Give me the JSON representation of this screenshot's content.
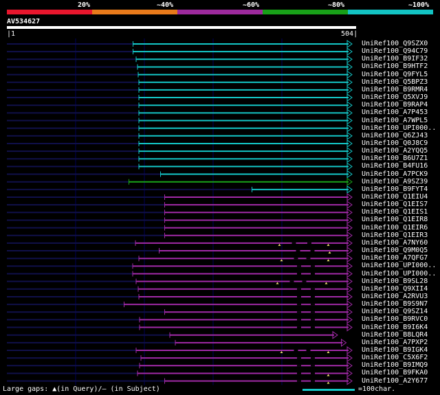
{
  "header": {
    "percent_labels": [
      "20%",
      "~40%",
      "~60%",
      "~80%",
      "~100%"
    ],
    "segment_colors": [
      "#e8162d",
      "#e87a1b",
      "#9d2a9d",
      "#18a018",
      "#13c4c4"
    ]
  },
  "query": {
    "name": "AV534627",
    "start_label": "1",
    "end_label": "504",
    "length": 504
  },
  "colors": {
    "cyan": "#14c8c8",
    "green": "#1aa51a",
    "purple": "#a22aa8",
    "navy": "#10104a",
    "grid": "#00005a",
    "marker": "#f0e070"
  },
  "hits": [
    {
      "id": "UniRef100_Q9SZX0",
      "color": "cyan",
      "start": 0.367
    },
    {
      "id": "UniRef100_Q94C79",
      "color": "cyan",
      "start": 0.367
    },
    {
      "id": "UniRef100_B9IF32",
      "color": "cyan",
      "start": 0.376
    },
    {
      "id": "UniRef100_B9HTF2",
      "color": "cyan",
      "start": 0.38
    },
    {
      "id": "UniRef100_Q9FYL5",
      "color": "cyan",
      "start": 0.382
    },
    {
      "id": "UniRef100_Q5BPZ3",
      "color": "cyan",
      "start": 0.384
    },
    {
      "id": "UniRef100_B9RMR4",
      "color": "cyan",
      "start": 0.384
    },
    {
      "id": "UniRef100_Q5XVJ9",
      "color": "cyan",
      "start": 0.384
    },
    {
      "id": "UniRef100_B9RAP4",
      "color": "cyan",
      "start": 0.384
    },
    {
      "id": "UniRef100_A7P453",
      "color": "cyan",
      "start": 0.384
    },
    {
      "id": "UniRef100_A7WPL5",
      "color": "cyan",
      "start": 0.384
    },
    {
      "id": "UniRef100_UPI000..",
      "color": "cyan",
      "start": 0.384
    },
    {
      "id": "UniRef100_Q6ZJ43",
      "color": "cyan",
      "start": 0.384
    },
    {
      "id": "UniRef100_Q0J8C9",
      "color": "cyan",
      "start": 0.384
    },
    {
      "id": "UniRef100_A2YQQ5",
      "color": "cyan",
      "start": 0.384
    },
    {
      "id": "UniRef100_B6U7Z1",
      "color": "cyan",
      "start": 0.384
    },
    {
      "id": "UniRef100_B4FU16",
      "color": "cyan",
      "start": 0.384
    },
    {
      "id": "UniRef100_A7PCK9",
      "color": "cyan",
      "start": 0.447
    },
    {
      "id": "UniRef100_A9SZ39",
      "color": "green",
      "start": 0.355
    },
    {
      "id": "UniRef100_B9FYT4",
      "color": "cyan",
      "start": 0.713
    },
    {
      "id": "UniRef100_Q1EIU4",
      "color": "purple",
      "start": 0.459
    },
    {
      "id": "UniRef100_Q1EIS7",
      "color": "purple",
      "start": 0.459
    },
    {
      "id": "UniRef100_Q1EIS1",
      "color": "purple",
      "start": 0.459
    },
    {
      "id": "UniRef100_Q1EIR8",
      "color": "purple",
      "start": 0.459
    },
    {
      "id": "UniRef100_Q1EIR6",
      "color": "purple",
      "start": 0.459
    },
    {
      "id": "UniRef100_Q1EIR3",
      "color": "purple",
      "start": 0.459
    },
    {
      "id": "UniRef100_A7NY60",
      "color": "purple",
      "start": 0.374,
      "markers": [
        0.793,
        0.935
      ],
      "gaps": [
        0.835,
        0.88
      ]
    },
    {
      "id": "UniRef100_Q9M0Q5",
      "color": "purple",
      "start": 0.443,
      "markers": [
        0.939
      ],
      "gaps": [
        0.847,
        0.889
      ]
    },
    {
      "id": "UniRef100_A7QFG7",
      "color": "purple",
      "start": 0.384,
      "markers": [
        0.799,
        0.935
      ],
      "gaps": [
        0.841,
        0.877
      ]
    },
    {
      "id": "UniRef100_UPI000..",
      "color": "purple",
      "start": 0.366,
      "gaps": [
        0.85,
        0.89
      ]
    },
    {
      "id": "UniRef100_UPI000..",
      "color": "purple",
      "start": 0.366,
      "gaps": [
        0.85,
        0.89
      ]
    },
    {
      "id": "UniRef100_B9SL28",
      "color": "purple",
      "start": 0.376,
      "markers": [
        0.787,
        0.929
      ],
      "gaps": [
        0.829,
        0.865
      ]
    },
    {
      "id": "UniRef100_Q9XII4",
      "color": "purple",
      "start": 0.382,
      "gaps": [
        0.85,
        0.89
      ]
    },
    {
      "id": "UniRef100_A2RVU3",
      "color": "purple",
      "start": 0.384,
      "gaps": [
        0.85,
        0.89
      ]
    },
    {
      "id": "UniRef100_B9S9N7",
      "color": "purple",
      "start": 0.341,
      "gaps": [
        0.85,
        0.89
      ]
    },
    {
      "id": "UniRef100_Q9SZ14",
      "color": "purple",
      "start": 0.459,
      "gaps": [
        0.85,
        0.89
      ]
    },
    {
      "id": "UniRef100_B9RVC0",
      "color": "purple",
      "start": 0.386,
      "gaps": [
        0.85,
        0.89
      ]
    },
    {
      "id": "UniRef100_B9I6K4",
      "color": "purple",
      "start": 0.386,
      "gaps": [
        0.85,
        0.89
      ]
    },
    {
      "id": "UniRef100_B8LQR4",
      "color": "purple",
      "start": 0.474,
      "end": 0.958
    },
    {
      "id": "UniRef100_A7PXP2",
      "color": "purple",
      "start": 0.49,
      "end": 0.983
    },
    {
      "id": "UniRef100_B9IGK4",
      "color": "purple",
      "start": 0.376,
      "markers": [
        0.799,
        0.935
      ],
      "gaps": [
        0.841,
        0.877
      ]
    },
    {
      "id": "UniRef100_C5X6F2",
      "color": "purple",
      "start": 0.39,
      "gaps": [
        0.85,
        0.89
      ]
    },
    {
      "id": "UniRef100_B9IMQ9",
      "color": "purple",
      "start": 0.386,
      "gaps": [
        0.85,
        0.89
      ]
    },
    {
      "id": "UniRef100_B9FKA0",
      "color": "purple",
      "start": 0.38,
      "markers": [
        0.935
      ],
      "gaps": [
        0.85,
        0.89
      ]
    },
    {
      "id": "UniRef100_A2Y677",
      "color": "purple",
      "start": 0.459,
      "markers": [
        0.935
      ],
      "gaps": [
        0.85,
        0.89
      ]
    }
  ],
  "footer": {
    "legend_text": "Large gaps: ▲(in Query)/– (in Subject)",
    "scale_text": "=100char."
  }
}
